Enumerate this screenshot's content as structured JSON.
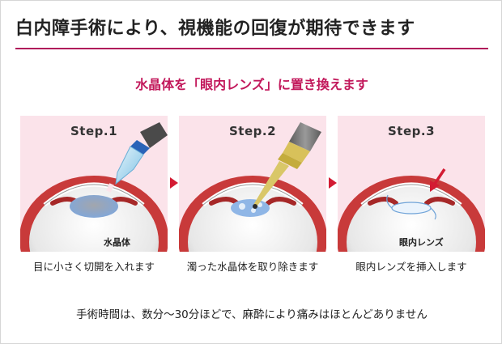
{
  "title": "白内障手術により、視機能の回復が期待できます",
  "subtitle": "水晶体を「眼内レンズ」に置き換えます",
  "steps": [
    {
      "label": "Step.1",
      "part_label": "水晶体",
      "caption": "目に小さく切開を入れます"
    },
    {
      "label": "Step.2",
      "caption": "濁った水晶体を取り除きます"
    },
    {
      "label": "Step.3",
      "part_label": "眼内レンズ",
      "caption": "眼内レンズを挿入します"
    }
  ],
  "footer": "手術時間は、数分〜30分ほどで、麻酔により痛みはほとんどありません",
  "colors": {
    "accent": "#c2185b",
    "title_rule": "#b0175a",
    "panel_bg": "#fbe3ea",
    "arrow": "#d31b33",
    "lens": "#8fb6e6",
    "iris": "#c83a3a"
  }
}
